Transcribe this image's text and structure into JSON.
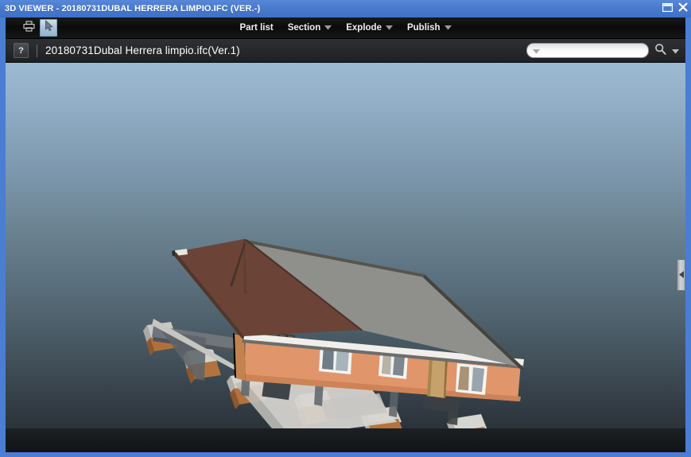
{
  "window": {
    "title": "3D VIEWER - 20180731DUBAL HERRERA LIMPIO.IFC (VER.-)",
    "maximize_label": "maximize-icon",
    "close_label": "close-icon",
    "frame_color": "#4a7ed4",
    "titlebar_color": "#4878cb"
  },
  "toolbar": {
    "print_label": "print-icon",
    "select_tool_label": "cursor-arrow-icon",
    "select_tool_selected": true,
    "menus": [
      {
        "label": "Part list",
        "has_dropdown": false
      },
      {
        "label": "Section",
        "has_dropdown": true
      },
      {
        "label": "Explode",
        "has_dropdown": true
      },
      {
        "label": "Publish",
        "has_dropdown": true
      }
    ]
  },
  "breadcrumb": {
    "help_label": "?",
    "file_name": "20180731Dubal Herrera limpio.ifc(Ver.1)"
  },
  "search": {
    "value": "",
    "placeholder": "",
    "dropdown_label": "chevron-down-icon",
    "magnifier_label": "search-icon",
    "options_label": "chevron-down-icon"
  },
  "viewport": {
    "panel_handle_label": "collapse-panel-arrow-icon",
    "background_top": "#9cbad2",
    "background_bottom": "#2b333a",
    "model": {
      "name": "house-3d-model",
      "roof_front_color": "#6a4436",
      "roof_back_color": "#8e8e8c",
      "wall_color": "#e09466",
      "window_frame_color": "#f2f2f2",
      "door_color": "#c4a068",
      "footing_color": "#d9d9d4",
      "timber_color": "#b4703c"
    }
  }
}
